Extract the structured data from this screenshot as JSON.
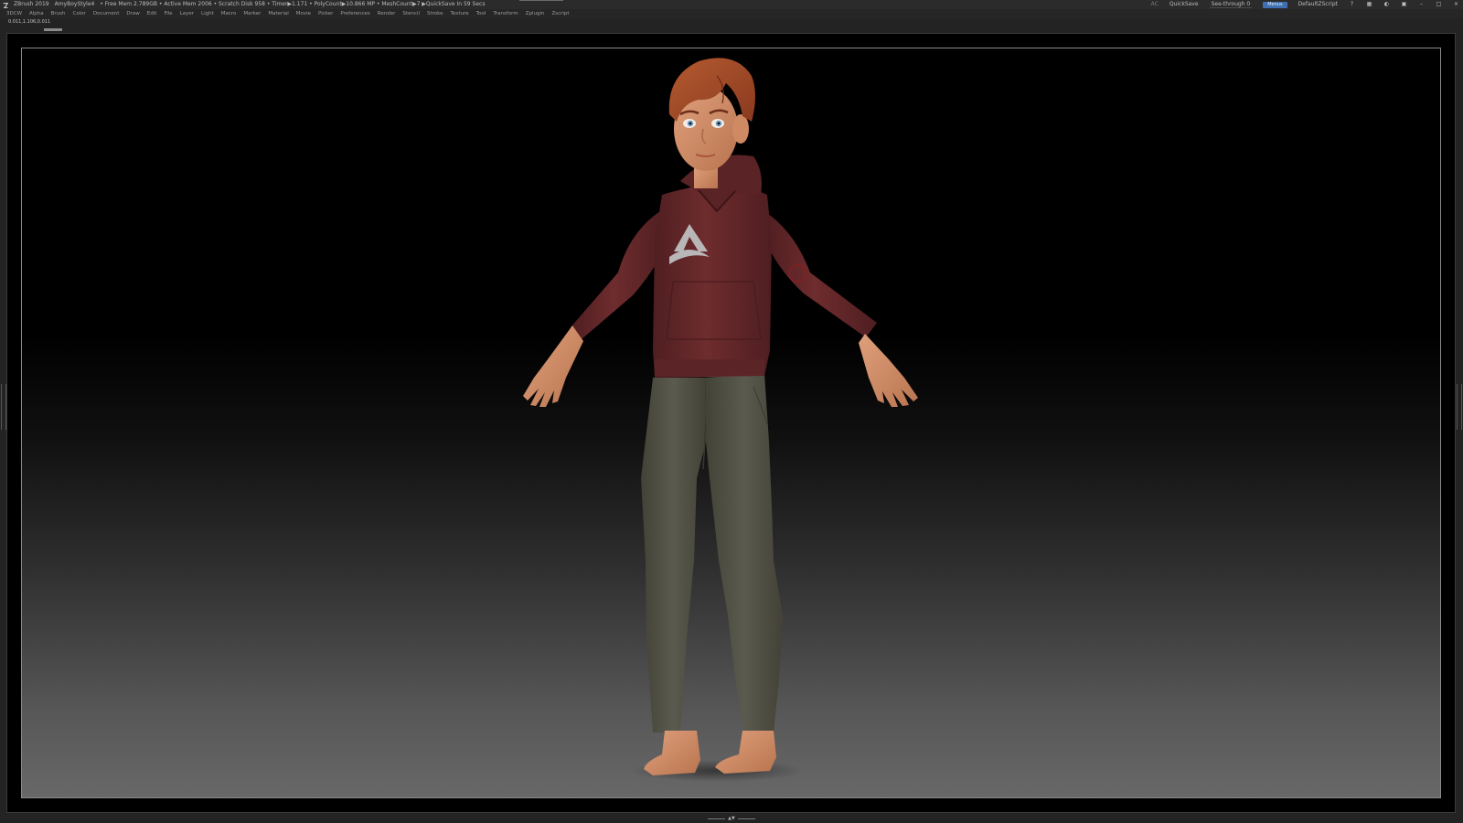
{
  "titlebar": {
    "app_name": "ZBrush 2019",
    "document_name": "AmyBoyStyle4",
    "stats": "• Free Mem 2.789GB • Active Mem 2006 • Scratch Disk 958 • Timer▶1.171 • PolyCount▶10.866 MP • MeshCount▶7  ▶QuickSave In 59 Secs",
    "ac_label": "AC",
    "quicksave_label": "QuickSave",
    "see_through_label": "See-through  0",
    "see_through_value": 0,
    "menus_label": "Menus",
    "default_script_label": "DefaultZScript",
    "icons": [
      "help-icon",
      "layout-icon",
      "palette-icon",
      "lock-icon",
      "minimize-icon",
      "restore-icon",
      "close-icon"
    ]
  },
  "menubar": {
    "items": [
      "3DCW",
      "Alpha",
      "Brush",
      "Color",
      "Document",
      "Draw",
      "Edit",
      "File",
      "Layer",
      "Light",
      "Macro",
      "Marker",
      "Material",
      "Movie",
      "Picker",
      "Preferences",
      "Render",
      "Stencil",
      "Stroke",
      "Texture",
      "Tool",
      "Transform",
      "Zplugin",
      "Zscript"
    ]
  },
  "coordbar": {
    "readout": "0.011,1.106,0.011"
  },
  "colors": {
    "hoodie": "#6e2c2e",
    "hoodie_shadow": "#4f1e21",
    "pants": "#5b5a4e",
    "pants_shadow": "#434237",
    "skin": "#e0a07c",
    "skin_shadow": "#b8744f",
    "hair": "#8a3a1f",
    "hair_highlight": "#b45a30",
    "logo": "#b9b6b8",
    "accent_blue": "#3f6fb3"
  }
}
